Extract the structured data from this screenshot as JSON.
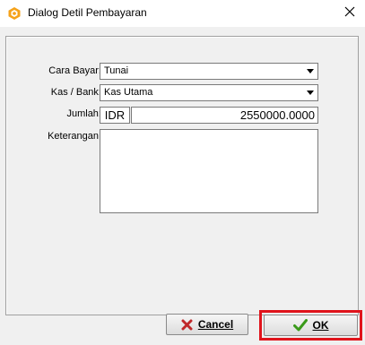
{
  "window": {
    "title": "Dialog Detil Pembayaran",
    "icon": "app-logo-icon",
    "close_icon": "close-icon"
  },
  "form": {
    "payment_method_label": "Cara Bayar:",
    "payment_method_value": "Tunai",
    "cash_bank_label": "Kas / Bank:",
    "cash_bank_value": "Kas Utama",
    "amount_label": "Jumlah:",
    "currency": "IDR",
    "amount_value": "2550000.0000",
    "notes_label": "Keterangan:",
    "notes_value": ""
  },
  "buttons": {
    "cancel_label": "Cancel",
    "ok_label": "OK"
  },
  "colors": {
    "highlight": "#e0141c",
    "icon_orange": "#f5a21a",
    "ok_check": "#3a9a1a",
    "cancel_x": "#c0282a"
  }
}
